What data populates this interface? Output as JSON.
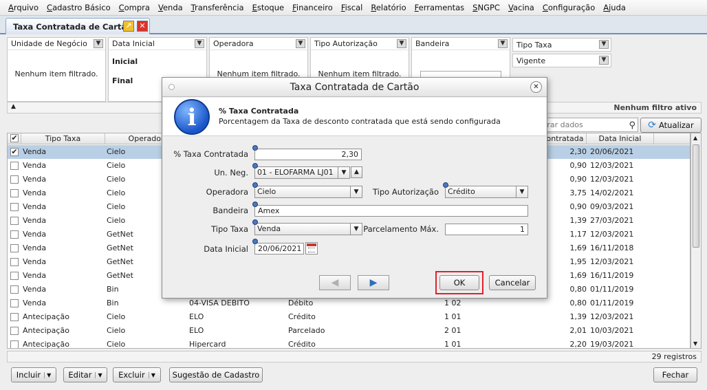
{
  "menu": [
    "Arquivo",
    "Cadastro Básico",
    "Compra",
    "Venda",
    "Transferência",
    "Estoque",
    "Financeiro",
    "Fiscal",
    "Relatório",
    "Ferramentas",
    "SNGPC",
    "Vacina",
    "Configuração",
    "Ajuda"
  ],
  "tab": {
    "title": "Taxa Contratada de Cartão"
  },
  "filters": {
    "unidade": {
      "title": "Unidade de Negócio",
      "empty": "Nenhum item filtrado."
    },
    "data_inicial": {
      "title": "Data Inicial",
      "inicial": "Inicial",
      "final": "Final"
    },
    "operadora": {
      "title": "Operadora",
      "empty": "Nenhum item filtrado."
    },
    "tipo_autorizacao": {
      "title": "Tipo Autorização",
      "empty": "Nenhum item filtrado."
    },
    "bandeira": {
      "title": "Bandeira"
    },
    "tipo_taxa": {
      "title": "Tipo Taxa"
    },
    "vigente": {
      "title": "Vigente"
    },
    "status": "Nenhum filtro ativo"
  },
  "search": {
    "placeholder": "trar dados"
  },
  "buttons": {
    "atualizar": "Atualizar",
    "incluir": "Incluir",
    "editar": "Editar",
    "excluir": "Excluir",
    "sugestao": "Sugestão de Cadastro",
    "fechar": "Fechar"
  },
  "table": {
    "headers": {
      "tipo_taxa": "Tipo Taxa",
      "operadora": "Operador",
      "contratada": "ontratada",
      "data_inicial": "Data Inicial"
    },
    "rows": [
      {
        "checked": true,
        "tipo": "Venda",
        "operadora": "Cielo",
        "bandeira": "",
        "autorizacao": "",
        "parc": "",
        "taxa": "2,30",
        "data": "20/06/2021"
      },
      {
        "checked": false,
        "tipo": "Venda",
        "operadora": "Cielo",
        "bandeira": "",
        "autorizacao": "",
        "parc": "",
        "taxa": "0,90",
        "data": "12/03/2021"
      },
      {
        "checked": false,
        "tipo": "Venda",
        "operadora": "Cielo",
        "bandeira": "",
        "autorizacao": "",
        "parc": "",
        "taxa": "0,90",
        "data": "12/03/2021"
      },
      {
        "checked": false,
        "tipo": "Venda",
        "operadora": "Cielo",
        "bandeira": "",
        "autorizacao": "",
        "parc": "",
        "taxa": "3,75",
        "data": "14/02/2021"
      },
      {
        "checked": false,
        "tipo": "Venda",
        "operadora": "Cielo",
        "bandeira": "",
        "autorizacao": "",
        "parc": "",
        "taxa": "0,90",
        "data": "09/03/2021"
      },
      {
        "checked": false,
        "tipo": "Venda",
        "operadora": "Cielo",
        "bandeira": "",
        "autorizacao": "",
        "parc": "",
        "taxa": "1,39",
        "data": "27/03/2021"
      },
      {
        "checked": false,
        "tipo": "Venda",
        "operadora": "GetNet",
        "bandeira": "",
        "autorizacao": "",
        "parc": "",
        "taxa": "1,17",
        "data": "12/03/2021"
      },
      {
        "checked": false,
        "tipo": "Venda",
        "operadora": "GetNet",
        "bandeira": "",
        "autorizacao": "",
        "parc": "",
        "taxa": "1,69",
        "data": "16/11/2018"
      },
      {
        "checked": false,
        "tipo": "Venda",
        "operadora": "GetNet",
        "bandeira": "",
        "autorizacao": "",
        "parc": "",
        "taxa": "1,95",
        "data": "12/03/2021"
      },
      {
        "checked": false,
        "tipo": "Venda",
        "operadora": "GetNet",
        "bandeira": "",
        "autorizacao": "",
        "parc": "",
        "taxa": "1,69",
        "data": "16/11/2019"
      },
      {
        "checked": false,
        "tipo": "Venda",
        "operadora": "Bin",
        "bandeira": "",
        "autorizacao": "",
        "parc": "",
        "taxa": "0,80",
        "data": "01/11/2019"
      },
      {
        "checked": false,
        "tipo": "Venda",
        "operadora": "Bin",
        "bandeira": "04-VISA DEBITO",
        "autorizacao": "Débito",
        "parc": "1  02",
        "taxa": "0,80",
        "data": "01/11/2019"
      },
      {
        "checked": false,
        "tipo": "Antecipação",
        "operadora": "Cielo",
        "bandeira": "ELO",
        "autorizacao": "Crédito",
        "parc": "1  01",
        "taxa": "1,39",
        "data": "12/03/2021"
      },
      {
        "checked": false,
        "tipo": "Antecipação",
        "operadora": "Cielo",
        "bandeira": "ELO",
        "autorizacao": "Parcelado",
        "parc": "2  01",
        "taxa": "2,01",
        "data": "10/03/2021"
      },
      {
        "checked": false,
        "tipo": "Antecipação",
        "operadora": "Cielo",
        "bandeira": "Hipercard",
        "autorizacao": "Crédito",
        "parc": "1  01",
        "taxa": "2,20",
        "data": "19/03/2021"
      }
    ]
  },
  "footer": {
    "count": "29 registros"
  },
  "modal": {
    "title": "Taxa Contratada de Cartão",
    "info_title": "% Taxa Contratada",
    "info_desc": "Porcentagem da Taxa de desconto contratada que está sendo configurada",
    "labels": {
      "taxa": "% Taxa Contratada",
      "un_neg": "Un. Neg.",
      "operadora": "Operadora",
      "tipo_autorizacao": "Tipo Autorização",
      "bandeira": "Bandeira",
      "tipo_taxa": "Tipo Taxa",
      "parcelamento": "Parcelamento Máx.",
      "data_inicial": "Data Inicial"
    },
    "values": {
      "taxa": "2,30",
      "un_neg": "01 - ELOFARMA LJ01",
      "operadora": "Cielo",
      "tipo_autorizacao": "Crédito",
      "bandeira": "Amex",
      "tipo_taxa": "Venda",
      "parcelamento": "1",
      "data_inicial": "20/06/2021"
    },
    "ok": "OK",
    "cancel": "Cancelar"
  }
}
